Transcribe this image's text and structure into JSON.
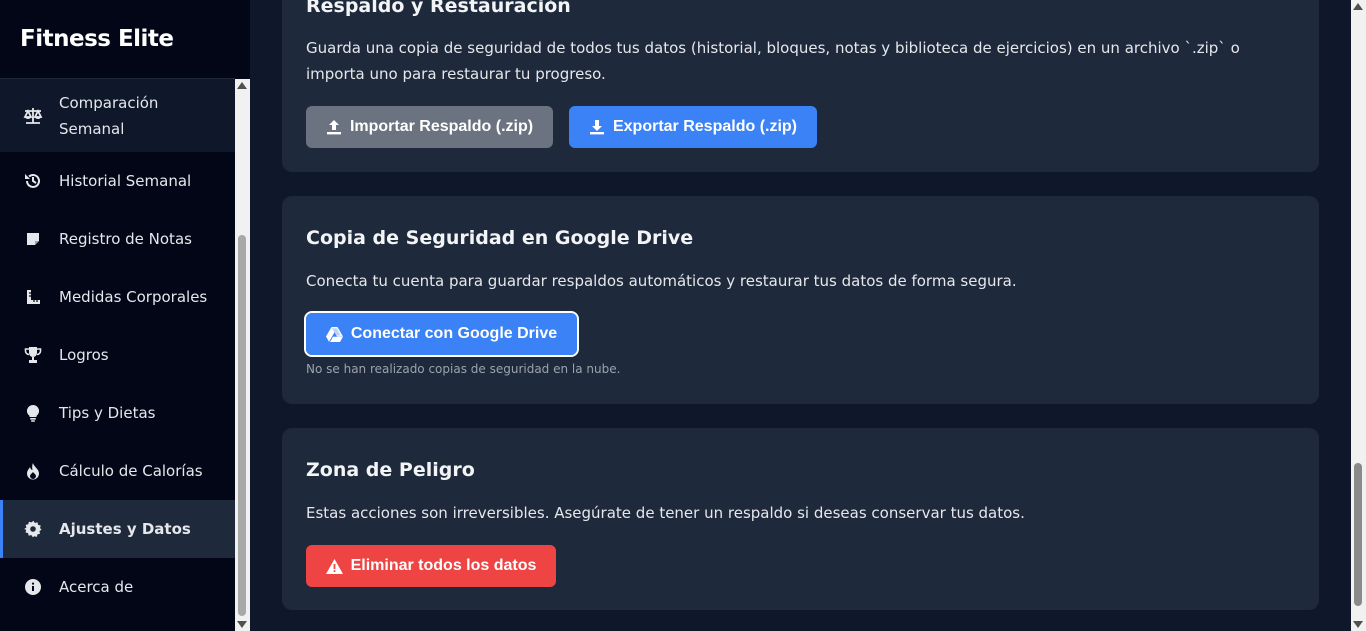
{
  "sidebar": {
    "brand": "Fitness Elite",
    "items": [
      {
        "label": "Comparación Semanal",
        "icon": "balance-scale-icon"
      },
      {
        "label": "Historial Semanal",
        "icon": "history-icon"
      },
      {
        "label": "Registro de Notas",
        "icon": "note-icon"
      },
      {
        "label": "Medidas Corporales",
        "icon": "ruler-icon"
      },
      {
        "label": "Logros",
        "icon": "trophy-icon"
      },
      {
        "label": "Tips y Dietas",
        "icon": "lightbulb-icon"
      },
      {
        "label": "Cálculo de Calorías",
        "icon": "fire-icon"
      },
      {
        "label": "Ajustes y Datos",
        "icon": "gear-icon",
        "active": true
      },
      {
        "label": "Acerca de",
        "icon": "info-icon"
      }
    ]
  },
  "backup": {
    "title": "Respaldo y Restauración",
    "description": "Guarda una copia de seguridad de todos tus datos (historial, bloques, notas y biblioteca de ejercicios) en un archivo `.zip` o importa uno para restaurar tu progreso.",
    "import_label": "Importar Respaldo (.zip)",
    "export_label": "Exportar Respaldo (.zip)"
  },
  "drive": {
    "title": "Copia de Seguridad en Google Drive",
    "description": "Conecta tu cuenta para guardar respaldos automáticos y restaurar tus datos de forma segura.",
    "connect_label": "Conectar con Google Drive",
    "status": "No se han realizado copias de seguridad en la nube."
  },
  "danger": {
    "title": "Zona de Peligro",
    "description": "Estas acciones son irreversibles. Asegúrate de tener un respaldo si deseas conservar tus datos.",
    "delete_label": "Eliminar todos los datos"
  },
  "colors": {
    "accent": "#3b82f6",
    "danger": "#ef4444",
    "neutral": "#6b7280",
    "card": "#1e293b",
    "background": "#0f172a",
    "sidebar": "#020617"
  }
}
